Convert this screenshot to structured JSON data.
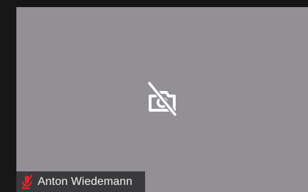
{
  "participant": {
    "name": "Anton Wiedemann",
    "video_state": "camera-off",
    "audio_state": "muted"
  },
  "icons": {
    "camera": "camera-off-icon",
    "microphone": "microphone-muted-icon"
  },
  "colors": {
    "tile_background": "#939095",
    "frame_background": "#1a1a1b",
    "name_bar_background": "#3a393b",
    "mute_icon": "#e0242a",
    "icon_white": "#ffffff"
  }
}
